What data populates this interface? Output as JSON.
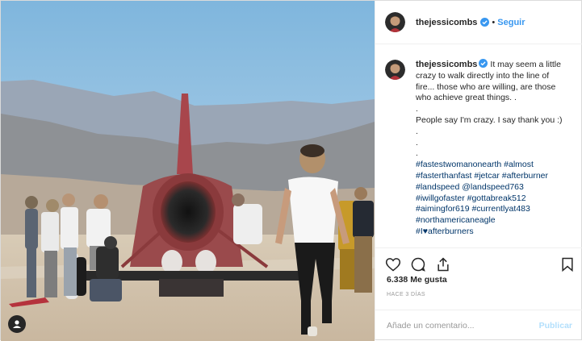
{
  "post": {
    "username": "thejessicombs",
    "follow_label": "Seguir",
    "separator": "•",
    "verified_color": "#3897f0",
    "caption_lines": [
      {
        "text": "It may seem a little",
        "with_user": true
      },
      {
        "text": "crazy to walk directly into the line of"
      },
      {
        "text": "fire... those who are willing, are those"
      },
      {
        "text": "who achieve great things. ."
      },
      {
        "text": "."
      },
      {
        "text": "People say I'm crazy. I say thank you :)"
      },
      {
        "text": "."
      },
      {
        "text": "."
      },
      {
        "text": "."
      }
    ],
    "hashtag_lines": [
      "#fastestwomanonearth #almost",
      "#fasterthanfast #jetcar #afterburner",
      "#landspeed @landspeed763",
      "#iwillgofaster #gottabreak512",
      "#aimingfor619 #currentlyat483",
      "#northamericaneagle",
      "#I♥afterburners"
    ],
    "likes": "6.338 Me gusta",
    "time_ago": "HACE 3 DÍAS",
    "comment_placeholder": "Añade un comentario...",
    "publish_label": "Publicar",
    "icons": [
      "heart-icon",
      "comment-icon",
      "share-icon",
      "bookmark-icon",
      "user-tag-icon"
    ],
    "colors": {
      "link": "#003569",
      "follow": "#3897f0",
      "publish_disabled": "#b2dffc",
      "muted": "#999999"
    }
  }
}
